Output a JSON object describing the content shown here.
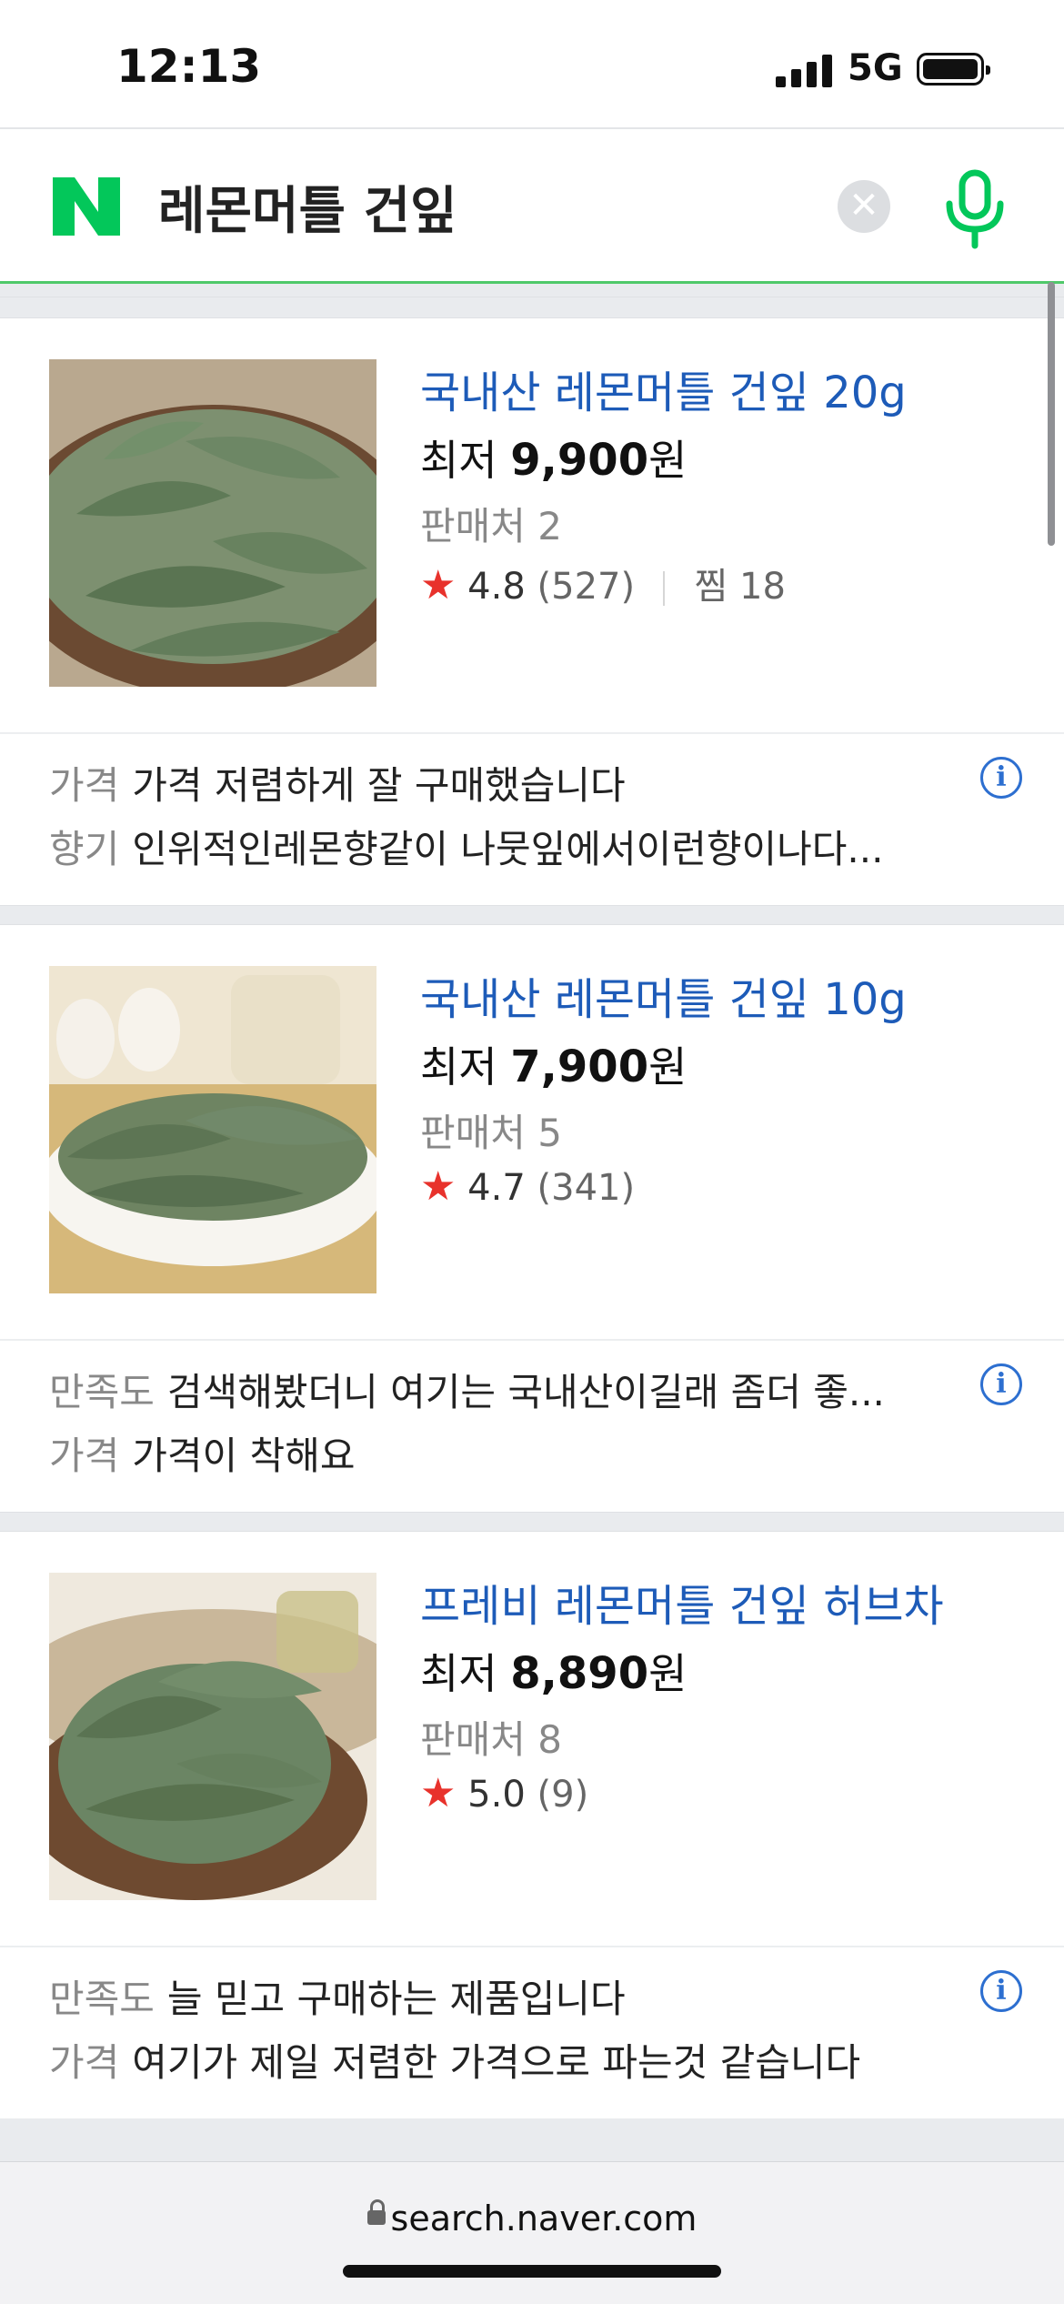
{
  "status_bar": {
    "time": "12:13",
    "network": "5G"
  },
  "search": {
    "query": "레몬머틀 건잎",
    "clear_icon": "✕"
  },
  "products": [
    {
      "title": "국내산 레몬머틀 건잎 20g",
      "price_prefix": "최저",
      "price": "9,900",
      "currency": "원",
      "sellers": "판매처 2",
      "rating": "4.8",
      "reviews": "(527)",
      "wish": "찜 18",
      "review_lines": [
        {
          "key": "가격",
          "text": "가격 저렴하게 잘 구매했습니다"
        },
        {
          "key": "향기",
          "text": "인위적인레몬향같이 나뭇잎에서이런향이나다..."
        }
      ]
    },
    {
      "title": "국내산 레몬머틀 건잎 10g",
      "price_prefix": "최저",
      "price": "7,900",
      "currency": "원",
      "sellers": "판매처 5",
      "rating": "4.7",
      "reviews": "(341)",
      "review_lines": [
        {
          "key": "만족도",
          "text": "검색해봤더니 여기는 국내산이길래 좀더 좋..."
        },
        {
          "key": "가격",
          "text": "가격이 착해요"
        }
      ]
    },
    {
      "title": "프레비 레몬머틀 건잎 허브차",
      "price_prefix": "최저",
      "price": "8,890",
      "currency": "원",
      "sellers": "판매처 8",
      "rating": "5.0",
      "reviews": "(9)",
      "review_lines": [
        {
          "key": "만족도",
          "text": "늘 믿고 구매하는 제품입니다"
        },
        {
          "key": "가격",
          "text": "여기가 제일 저렴한 가격으로 파는것 같습니다"
        }
      ]
    }
  ],
  "icons": {
    "star": "★",
    "info": "i"
  },
  "url_bar": {
    "url": "search.naver.com"
  },
  "colors": {
    "naver_green": "#03c75a",
    "title_blue": "#1d5bb8",
    "star_red": "#e8322c"
  }
}
